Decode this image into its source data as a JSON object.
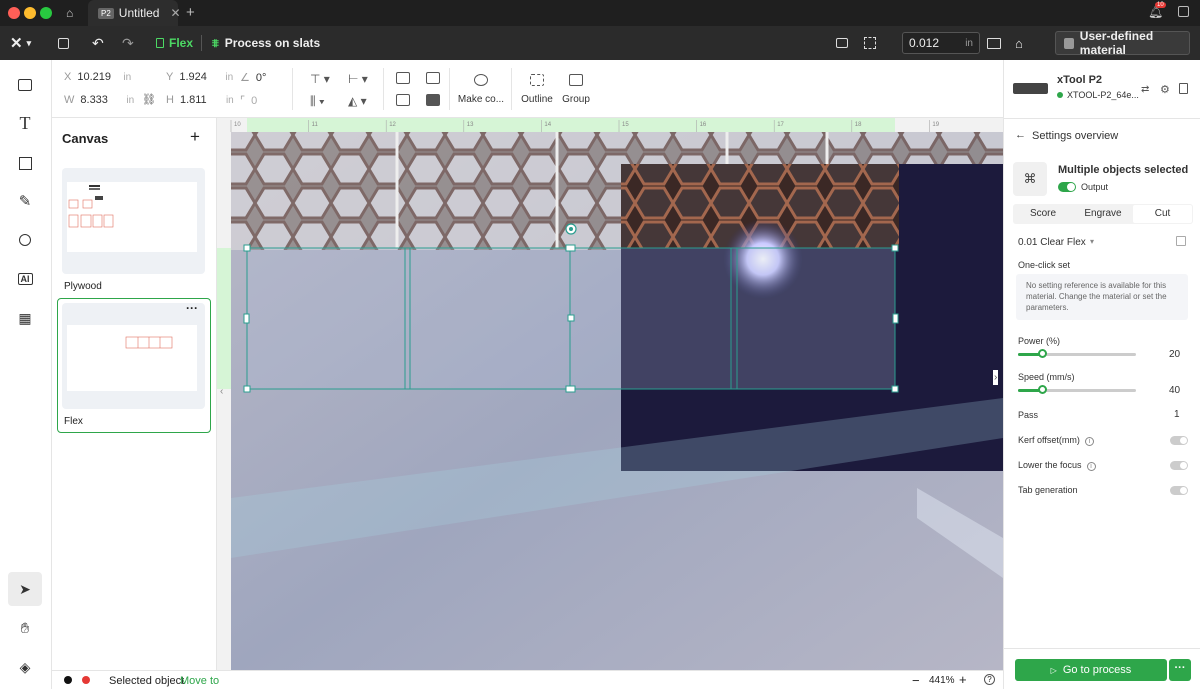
{
  "titlebar": {
    "tab_title": "Untitled",
    "tab_badge": "P2",
    "notification_count": "10"
  },
  "toolbar": {
    "doc_name": "Flex",
    "process_mode": "Process on slats",
    "thickness_value": "0.012",
    "thickness_unit": "in",
    "material": "User-defined material"
  },
  "props": {
    "x_label": "X",
    "x_value": "10.219",
    "y_label": "Y",
    "y_value": "1.924",
    "w_label": "W",
    "w_value": "8.333",
    "h_label": "H",
    "h_value": "1.811",
    "unit": "in",
    "rotation": "0°",
    "corner": "0",
    "make_label": "Make co...",
    "outline_label": "Outline",
    "group_label": "Group"
  },
  "canvas_panel": {
    "title": "Canvas",
    "items": [
      {
        "name": "Plywood"
      },
      {
        "name": "Flex"
      }
    ]
  },
  "ruler": {
    "ticks": [
      "10",
      "11",
      "12",
      "13",
      "14",
      "15",
      "16",
      "17",
      "18",
      "19"
    ]
  },
  "status": {
    "selected_label": "Selected object",
    "move_label": "Move to",
    "zoom": "441%"
  },
  "device": {
    "name": "xTool P2",
    "id": "XTOOL-P2_64e..."
  },
  "settings": {
    "back_label": "Settings overview",
    "selection_title": "Multiple objects selected",
    "output_label": "Output",
    "tabs": [
      "Score",
      "Engrave",
      "Cut"
    ],
    "active_tab": "Cut",
    "preset": "0.01 Clear Flex",
    "one_click_label": "One-click set",
    "notice": "No setting reference is available for this material. Change the material or set the parameters.",
    "power_label": "Power (%)",
    "power_value": "20",
    "speed_label": "Speed (mm/s)",
    "speed_value": "40",
    "pass_label": "Pass",
    "pass_value": "1",
    "kerf_label": "Kerf offset(mm)",
    "focus_label": "Lower the focus",
    "tab_gen_label": "Tab generation",
    "process_button": "Go to process",
    "power_fraction": 0.2,
    "speed_fraction": 0.2
  },
  "colors": {
    "accent": "#2ea64a",
    "selection": "#2a9d8f",
    "dark_bar": "#2b2b2b"
  }
}
